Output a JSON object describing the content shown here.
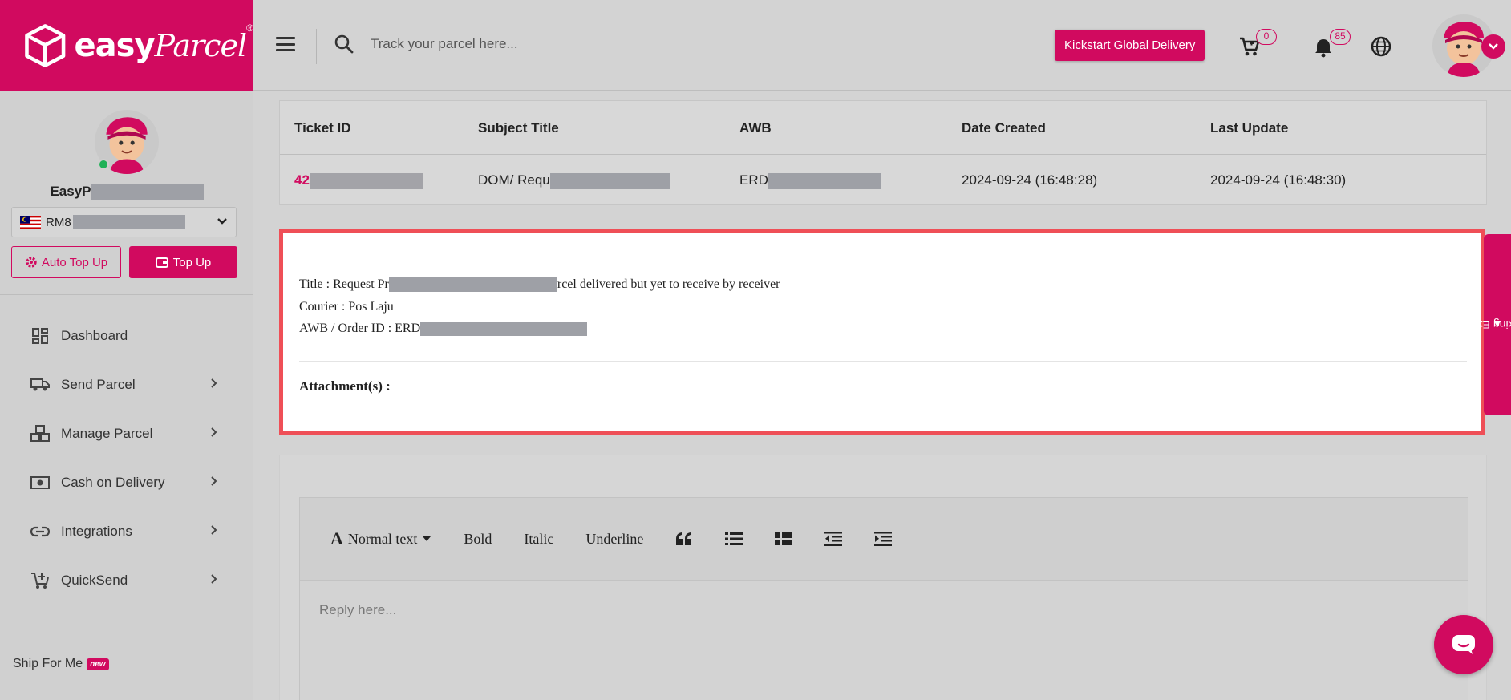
{
  "brand": {
    "name": "easy",
    "name_accent": "Parcel",
    "registered": "®"
  },
  "header": {
    "search_placeholder": "Track your parcel here...",
    "kickstart_label": "Kickstart Global Delivery",
    "cart_count": "0",
    "notification_count": "85"
  },
  "sidebar": {
    "user_name": "EasyP",
    "wallet_prefix": "RM8",
    "auto_topup_label": "Auto Top Up",
    "topup_label": "Top Up",
    "nav": [
      {
        "label": "Dashboard",
        "icon": "dashboard-icon"
      },
      {
        "label": "Send Parcel",
        "icon": "truck-icon"
      },
      {
        "label": "Manage Parcel",
        "icon": "boxes-icon"
      },
      {
        "label": "Cash on Delivery",
        "icon": "cash-icon"
      },
      {
        "label": "Integrations",
        "icon": "link-icon"
      },
      {
        "label": "QuickSend",
        "icon": "cart-plus-icon"
      }
    ],
    "ship_for_me": "Ship For Me",
    "new_badge": "new"
  },
  "ticket_table": {
    "headers": [
      "Ticket ID",
      "Subject Title",
      "AWB",
      "Date Created",
      "Last Update"
    ],
    "row": {
      "ticket_id": "42",
      "subject": "DOM/ Requ",
      "awb": "ERD",
      "date_created": "2024-09-24 (16:48:28)",
      "last_update": "2024-09-24 (16:48:30)"
    }
  },
  "ticket_detail": {
    "title_prefix": "Title : Request Pr",
    "title_suffix": "rcel delivered but yet to receive by receiver",
    "courier": "Courier : Pos Laju",
    "awb_prefix": "AWB / Order ID : ERD",
    "attachments_label": "Attachment(s) :"
  },
  "editor": {
    "format_label": "Normal text",
    "bold_label": "Bold",
    "italic_label": "Italic",
    "underline_label": "Underline",
    "reply_placeholder": "Reply here..."
  },
  "rate_tab_label": "Rate Booking Experience",
  "colors": {
    "brand": "#d10a5f",
    "highlight_border": "#ef4f57",
    "online": "#1fb157"
  }
}
